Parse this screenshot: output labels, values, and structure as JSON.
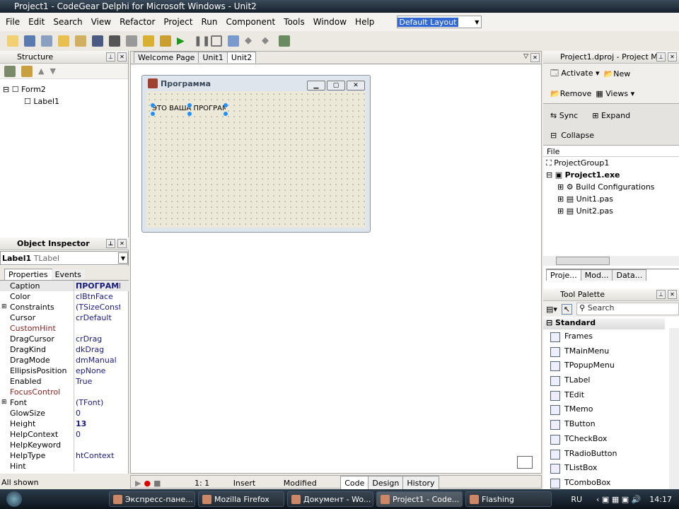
{
  "window": {
    "title": "Project1 - CodeGear Delphi for Microsoft Windows - Unit2"
  },
  "menu": [
    "File",
    "Edit",
    "Search",
    "View",
    "Refactor",
    "Project",
    "Run",
    "Component",
    "Tools",
    "Window",
    "Help"
  ],
  "layout_combo": {
    "value": "Default Layout"
  },
  "structure": {
    "title": "Structure",
    "tree": [
      "Form2",
      "Label1"
    ]
  },
  "object_inspector": {
    "title": "Object Inspector",
    "selected": "Label1",
    "selected_type": "TLabel",
    "tabs": [
      "Properties",
      "Events"
    ],
    "properties": [
      {
        "name": "Caption",
        "value": "ПРОГРАММ",
        "bold": true
      },
      {
        "name": "Color",
        "value": "clBtnFace"
      },
      {
        "name": "Constraints",
        "value": "(TSizeConstra",
        "expand": true
      },
      {
        "name": "Cursor",
        "value": "crDefault"
      },
      {
        "name": "CustomHint",
        "value": "",
        "red": true
      },
      {
        "name": "DragCursor",
        "value": "crDrag"
      },
      {
        "name": "DragKind",
        "value": "dkDrag"
      },
      {
        "name": "DragMode",
        "value": "dmManual"
      },
      {
        "name": "EllipsisPosition",
        "value": "epNone"
      },
      {
        "name": "Enabled",
        "value": "True"
      },
      {
        "name": "FocusControl",
        "value": "",
        "red": true
      },
      {
        "name": "Font",
        "value": "(TFont)",
        "expand": true
      },
      {
        "name": "GlowSize",
        "value": "0"
      },
      {
        "name": "Height",
        "value": "13",
        "bold": true
      },
      {
        "name": "HelpContext",
        "value": "0"
      },
      {
        "name": "HelpKeyword",
        "value": ""
      },
      {
        "name": "HelpType",
        "value": "htContext"
      },
      {
        "name": "Hint",
        "value": ""
      }
    ],
    "status": "All shown"
  },
  "editor": {
    "tabs": [
      "Welcome Page",
      "Unit1",
      "Unit2"
    ],
    "active_tab": "Unit2",
    "form": {
      "caption": "Программа",
      "label": "ЭТО ВАША ПРОГРАММ"
    },
    "status": {
      "position": "1:   1",
      "mode": "Insert",
      "modified": "Modified"
    },
    "bottom_tabs": [
      "Code",
      "Design",
      "History"
    ]
  },
  "project_manager": {
    "title": "Project1.dproj - Project M...",
    "buttons": {
      "activate": "Activate",
      "new": "New",
      "remove": "Remove",
      "views": "Views",
      "sync": "Sync",
      "expand": "Expand",
      "collapse": "Collapse"
    },
    "column": "File",
    "tree": {
      "group": "ProjectGroup1",
      "project": "Project1.exe",
      "children": [
        "Build Configurations",
        "Unit1.pas",
        "Unit2.pas"
      ]
    },
    "tabs": [
      "Proje...",
      "Mod...",
      "Data..."
    ]
  },
  "tool_palette": {
    "title": "Tool Palette",
    "search_placeholder": "Search",
    "category": "Standard",
    "items": [
      "Frames",
      "TMainMenu",
      "TPopupMenu",
      "TLabel",
      "TEdit",
      "TMemo",
      "TButton",
      "TCheckBox",
      "TRadioButton",
      "TListBox",
      "TComboBox"
    ]
  },
  "taskbar": {
    "items": [
      "Экспресс-пане...",
      "Mozilla Firefox",
      "Документ - Wo...",
      "Project1 - Code...",
      "Flashing"
    ],
    "active": "Project1 - Code...",
    "lang": "RU",
    "clock": "14:17"
  }
}
